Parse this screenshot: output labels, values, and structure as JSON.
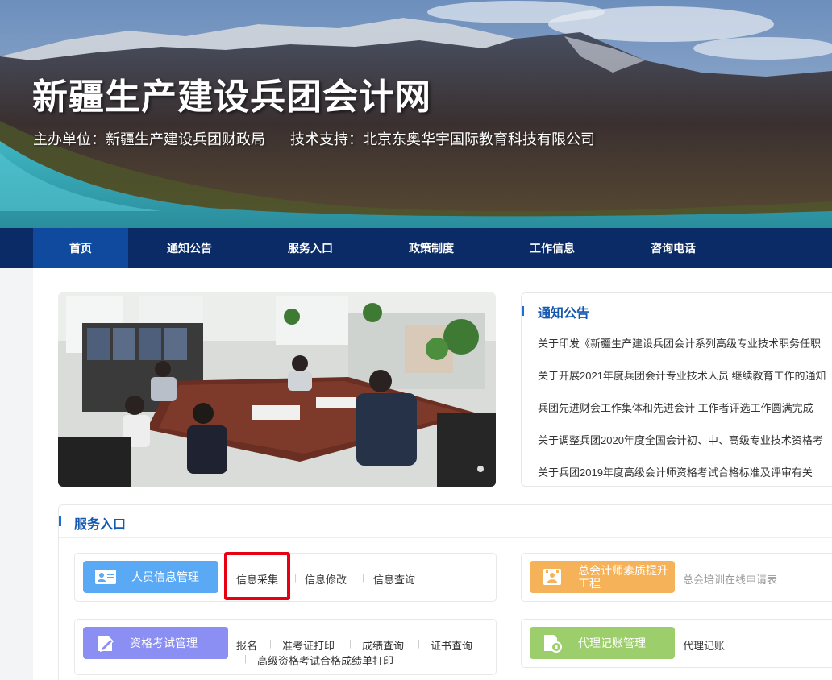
{
  "header": {
    "site_title": "新疆生产建设兵团会计网",
    "host": "主办单位：新疆生产建设兵团财政局",
    "support": "技术支持：北京东奥华宇国际教育科技有限公司"
  },
  "nav": {
    "items": [
      "首页",
      "通知公告",
      "服务入口",
      "政策制度",
      "工作信息",
      "咨询电话"
    ],
    "active": "首页"
  },
  "notice": {
    "title": "通知公告",
    "items": [
      "关于印发《新疆生产建设兵团会计系列高级专业技术职务任职",
      "关于开展2021年度兵团会计专业技术人员 继续教育工作的通知",
      "兵团先进财会工作集体和先进会计 工作者评选工作圆满完成",
      "关于调整兵团2020年度全国会计初、中、高级专业技术资格考",
      "关于兵团2019年度高级会计师资格考试合格标准及评审有关"
    ]
  },
  "service": {
    "title": "服务入口",
    "personnel": {
      "label": "人员信息管理",
      "links": [
        "信息采集",
        "信息修改",
        "信息查询"
      ]
    },
    "chief": {
      "label": "总会计师素质提升工程",
      "links": [
        "总会培训在线申请表"
      ]
    },
    "exam": {
      "label": "资格考试管理",
      "links": [
        "报名",
        "准考证打印",
        "成绩查询",
        "证书查询",
        "高级资格考试合格成绩单打印"
      ]
    },
    "agency": {
      "label": "代理记账管理",
      "links": [
        "代理记账"
      ]
    }
  },
  "colors": {
    "nav_bg": "#0a2b66",
    "nav_active": "#0f4a9e",
    "accent": "#1558b0",
    "personnel_pill": "#5aa9f5",
    "chief_pill": "#f5b259",
    "exam_pill": "#8b8ef3",
    "agency_pill": "#9ccf6b",
    "highlight": "#e60012"
  }
}
